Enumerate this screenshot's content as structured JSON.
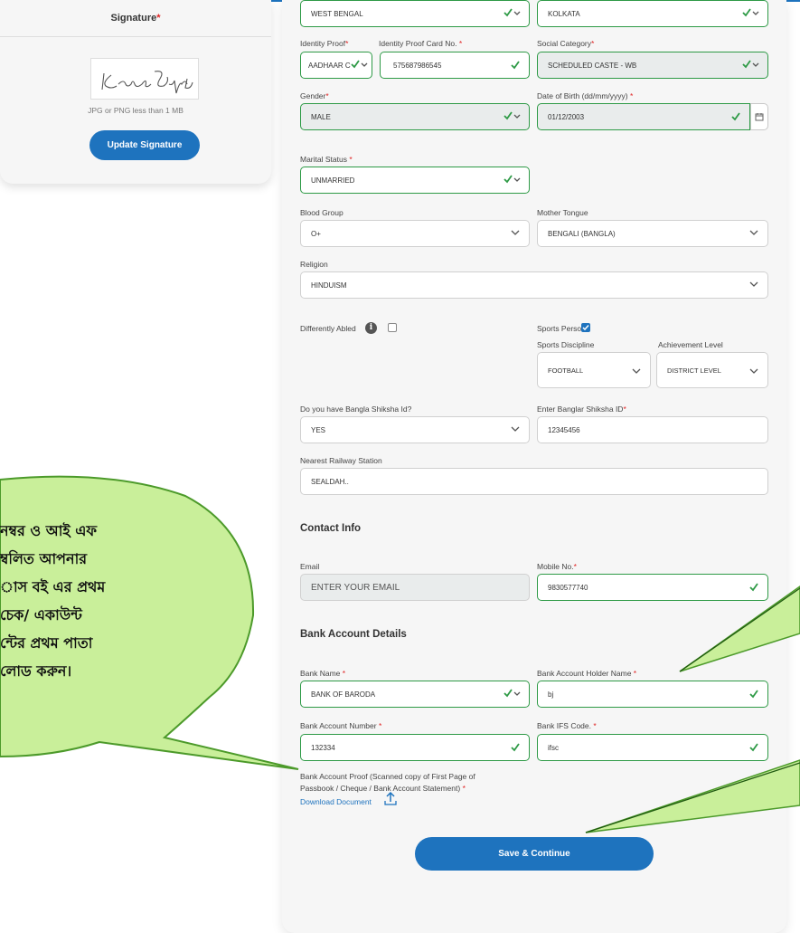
{
  "signature": {
    "title": "Signature",
    "required_mark": "*",
    "image_text": "Kedar Gupta",
    "note": "JPG or PNG less than 1 MB",
    "update_label": "Update Signature"
  },
  "form": {
    "state_value": "WEST BENGAL",
    "district_value": "KOLKATA",
    "identity_proof": {
      "label": "Identity Proof",
      "value": "AADHAAR C"
    },
    "identity_proof_card_no": {
      "label": "Identity Proof Card No.",
      "value": "575687986545"
    },
    "social_category": {
      "label": "Social Category",
      "value": "SCHEDULED CASTE - WB"
    },
    "gender": {
      "label": "Gender",
      "value": "MALE"
    },
    "dob": {
      "label": "Date of Birth (dd/mm/yyyy)",
      "value": "01/12/2003"
    },
    "marital_status": {
      "label": "Marital Status",
      "value": "UNMARRIED"
    },
    "blood_group": {
      "label": "Blood Group",
      "value": "O+"
    },
    "mother_tongue": {
      "label": "Mother Tongue",
      "value": "BENGALI (BANGLA)"
    },
    "religion": {
      "label": "Religion",
      "value": "HINDUISM"
    },
    "differently_abled": {
      "label": "Differently Abled",
      "checked": false
    },
    "sports_person": {
      "label": "Sports Person?",
      "checked": true
    },
    "sports_discipline": {
      "label": "Sports Discipline",
      "value": "FOOTBALL"
    },
    "achievement_level": {
      "label": "Achievement Level",
      "value": "DISTRICT LEVEL"
    },
    "bangla_shiksha": {
      "label": "Do you have Bangla Shiksha Id?",
      "value": "YES"
    },
    "banglar_shiksha_id": {
      "label": "Enter Banglar Shiksha ID",
      "value": "12345456"
    },
    "railway_station": {
      "label": "Nearest Railway Station",
      "value": "SEALDAH.."
    },
    "contact_section": "Contact Info",
    "email": {
      "label": "Email",
      "placeholder": "ENTER YOUR EMAIL"
    },
    "mobile": {
      "label": "Mobile No.",
      "value": "9830577740"
    },
    "bank_section": "Bank Account Details",
    "bank_name": {
      "label": "Bank Name",
      "value": "BANK OF BARODA"
    },
    "holder_name": {
      "label": "Bank Account Holder Name",
      "value": "bj"
    },
    "account_number": {
      "label": "Bank Account Number",
      "value": "132334"
    },
    "ifs_code": {
      "label": "Bank IFS Code.",
      "value": "ifsc"
    },
    "bank_proof": {
      "label_line1": "Bank Account Proof (Scanned copy of First Page of",
      "label_line2": "Passbook / Cheque / Bank Account Statement)"
    },
    "download_label": "Download Document",
    "save_label": "Save & Continue",
    "required_mark": "*"
  },
  "callout": {
    "lines": [
      "নম্বর ও আই এফ",
      "ম্বলিত আপনার",
      "াস বই এর প্রথম",
      "চেক/ একাউন্ট",
      "ন্টের প্রথম পাতা",
      "লোড করুন।"
    ]
  },
  "colors": {
    "accent": "#1e73be",
    "valid": "#2e9a46",
    "bubble": "#c9ef9a",
    "required": "#e02424"
  }
}
